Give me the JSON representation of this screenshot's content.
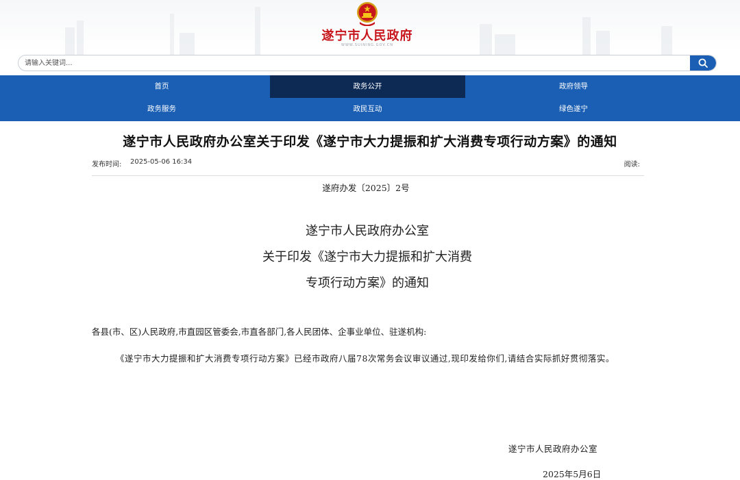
{
  "header": {
    "site_name": "遂宁市人民政府",
    "site_url": "WWW.SUINING.GOV.CN"
  },
  "search": {
    "placeholder": "请输入关键词..."
  },
  "nav": {
    "items": [
      {
        "label": "首页",
        "active": false
      },
      {
        "label": "政务公开",
        "active": true
      },
      {
        "label": "政府领导",
        "active": false
      },
      {
        "label": "政务服务",
        "active": false
      },
      {
        "label": "政民互动",
        "active": false
      },
      {
        "label": "绿色遂宁",
        "active": false
      }
    ]
  },
  "article": {
    "title": "遂宁市人民政府办公室关于印发《遂宁市大力提振和扩大消费专项行动方案》的通知",
    "publish_label": "发布时间:",
    "publish_date": "2025-05-06 16:34",
    "read_label": "阅读:",
    "doc_number": "遂府办发〔2025〕2号",
    "heading_lines": [
      "遂宁市人民政府办公室",
      "关于印发《遂宁市大力提振和扩大消费",
      "专项行动方案》的通知"
    ],
    "salutation": "各县(市、区)人民政府,市直园区管委会,市直各部门,各人民团体、企事业单位、驻遂机构:",
    "body": "《遂宁市大力提振和扩大消费专项行动方案》已经市政府八届78次常务会议审议通过,现印发给你们,请结合实际抓好贯彻落实。",
    "signature": "遂宁市人民政府办公室",
    "sign_date": "2025年5月6日"
  },
  "colors": {
    "brand_blue": "#1a5fb4",
    "nav_active": "#0d2a55",
    "logo_red": "#c8161d"
  }
}
